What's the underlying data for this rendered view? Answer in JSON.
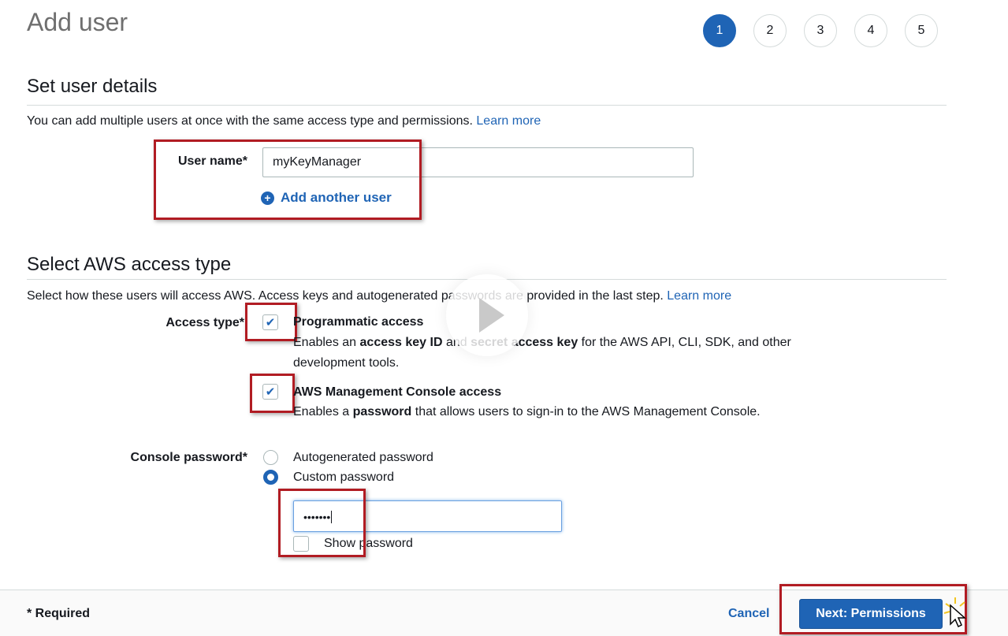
{
  "page": {
    "title": "Add user"
  },
  "steps": [
    "1",
    "2",
    "3",
    "4",
    "5"
  ],
  "details": {
    "title": "Set user details",
    "description": "You can add multiple users at once with the same access type and permissions.",
    "learn_more": "Learn more",
    "user_name_label": "User name*",
    "user_name_value": "myKeyManager",
    "add_another": "Add another user"
  },
  "access": {
    "title": "Select AWS access type",
    "description": "Select how these users will access AWS. Access keys and autogenerated passwords are provided in the last step.",
    "learn_more": "Learn more",
    "access_type_label": "Access type*",
    "programmatic": {
      "title": "Programmatic access",
      "desc_1": "Enables an ",
      "desc_bold_1": "access key ID",
      "desc_2": " and ",
      "desc_bold_2": "secret access key",
      "desc_3": " for the AWS API, CLI, SDK, and other development tools.",
      "checked": true
    },
    "console": {
      "title": "AWS Management Console access",
      "desc_1": "Enables a ",
      "desc_bold": "password",
      "desc_2": " that allows users to sign-in to the AWS Management Console.",
      "checked": true
    },
    "password_label": "Console password*",
    "autogen_label": "Autogenerated password",
    "custom_label": "Custom password",
    "password_value": "•••••••",
    "show_password": "Show password"
  },
  "footer": {
    "required": "* Required",
    "cancel": "Cancel",
    "next": "Next: Permissions"
  },
  "icons": {
    "check": "checkmark-icon",
    "plus": "plus-circle-icon",
    "play": "play-icon",
    "cursor": "pointer-cursor-icon"
  },
  "colors": {
    "accent": "#1f64b5",
    "highlight": "#b11c23"
  }
}
